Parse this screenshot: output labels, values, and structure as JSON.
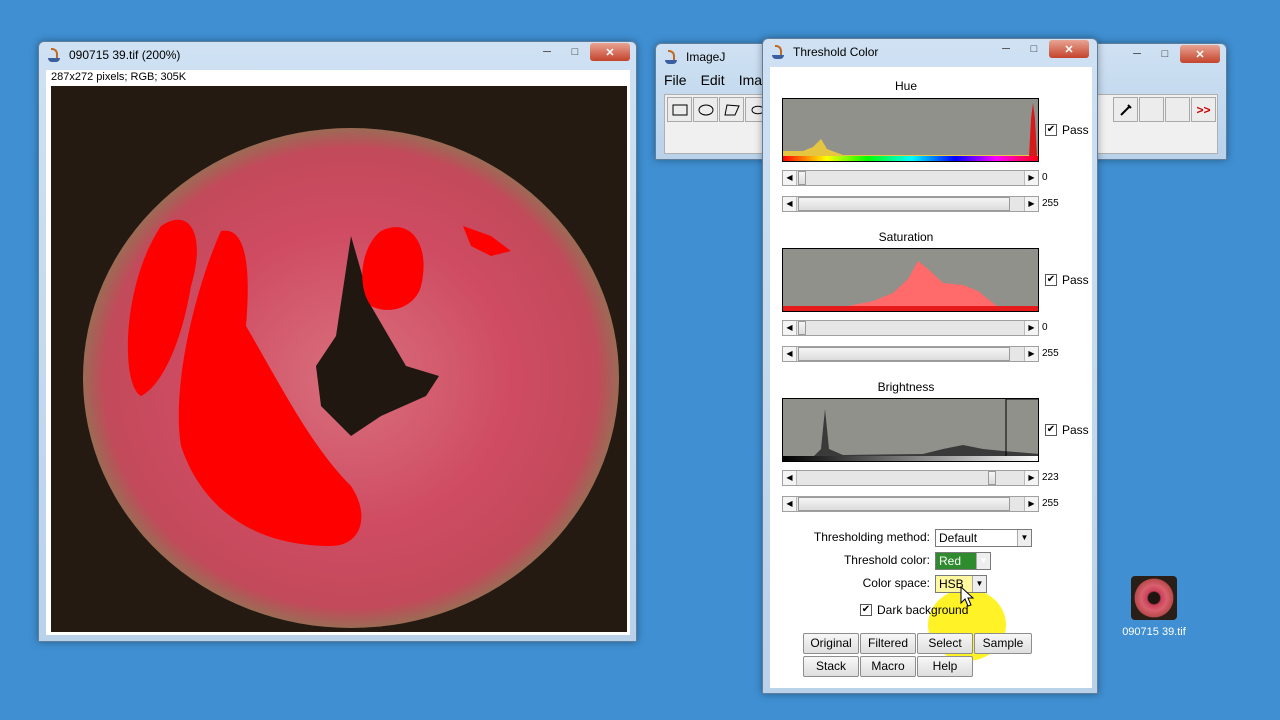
{
  "image_window": {
    "title": "090715 39.tif (200%)",
    "info": "287x272 pixels; RGB; 305K"
  },
  "imagej_window": {
    "title": "ImageJ",
    "menu": [
      "File",
      "Edit",
      "Ima"
    ],
    "more_label": ">>"
  },
  "threshold_window": {
    "title": "Threshold Color",
    "hue": {
      "label": "Hue",
      "pass": "Pass",
      "min": "0",
      "max": "255"
    },
    "saturation": {
      "label": "Saturation",
      "pass": "Pass",
      "min": "0",
      "max": "255"
    },
    "brightness": {
      "label": "Brightness",
      "pass": "Pass",
      "min": "223",
      "max": "255"
    },
    "thresholding_method_label": "Thresholding method:",
    "thresholding_method_value": "Default",
    "threshold_color_label": "Threshold color:",
    "threshold_color_value": "Red",
    "color_space_label": "Color space:",
    "color_space_value": "HSB",
    "dark_background_label": "Dark background",
    "buttons": {
      "original": "Original",
      "filtered": "Filtered",
      "select": "Select",
      "sample": "Sample",
      "stack": "Stack",
      "macro": "Macro",
      "help": "Help"
    }
  },
  "desktop": {
    "icon_label": "090715 39.tif"
  },
  "colors": {
    "desktop": "#3f8fd2",
    "threshold_red": "#ff0000",
    "threshold_color_select": "#2e8b2e",
    "cursor_highlight": "#fff000"
  }
}
